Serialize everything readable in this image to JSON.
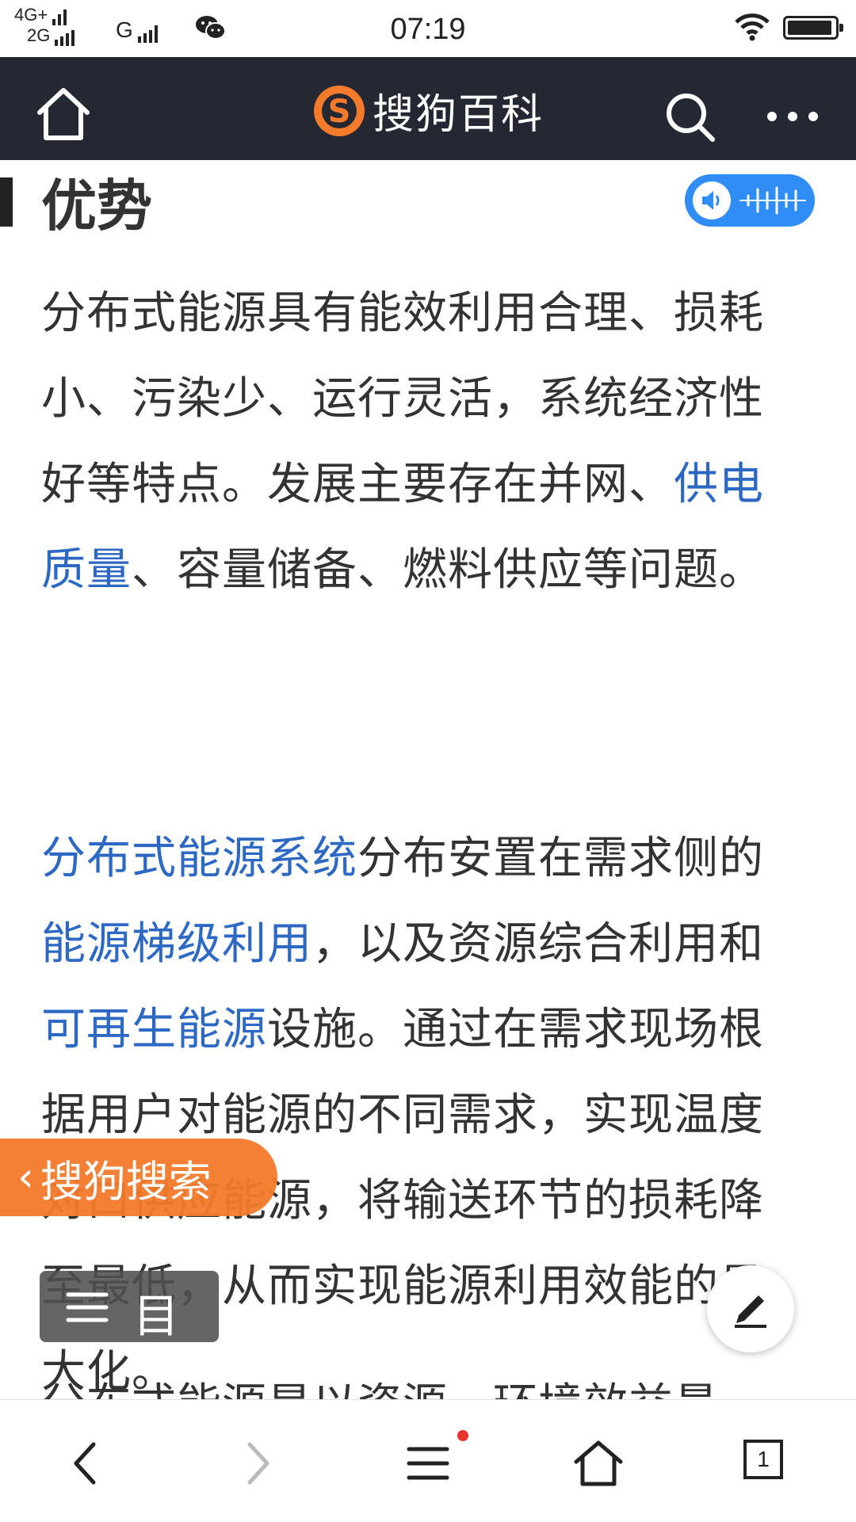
{
  "status_bar": {
    "network_1": "4G+",
    "network_2": "2G",
    "network_3": "G",
    "time": "07:19",
    "battery_level": 0.95
  },
  "topbar": {
    "logo_letter": "S",
    "logo_text": "搜狗百科",
    "icons": [
      "home-icon",
      "search-icon",
      "more-icon"
    ]
  },
  "section": {
    "title": "优势",
    "audio_icons": [
      "speaker-icon",
      "waveform-icon"
    ]
  },
  "paragraph_1": {
    "t1": "分布式能源具有能效利用合理、损耗小、污染少、运行灵活，系统经济性好等特点。发展主要存在并网、",
    "link1": "供电质量",
    "t2": "、容量储备、燃料供应等问题。"
  },
  "paragraph_2": {
    "link1": "分布式能源系统",
    "t1": "分布安置在需求侧的",
    "link2": "能源梯级利用",
    "t2": "，以及资源综合利用和",
    "link3": "可再生能源",
    "t3": "设施。通过在需求现场根据用户对能源的不同需求，实现温度对口供应能源，将输送环节的损耗降至最低，从而实现能源利用效能的最大化。"
  },
  "paragraph_3_partial": "分布式能源是以资源、环境效益最",
  "floating": {
    "search_label": "搜狗搜索",
    "toc_label": "目",
    "edit_icon": "pencil-icon"
  },
  "bottom_nav": {
    "tab_count": "1",
    "icons": [
      "back-icon",
      "forward-icon",
      "menu-icon",
      "home-icon",
      "tabs-icon"
    ]
  },
  "colors": {
    "topbar_bg": "#232833",
    "link": "#2d69c4",
    "accent_orange": "#f47a2c",
    "audio_blue": "#2f8df5",
    "notification_red": "#e8332e"
  }
}
